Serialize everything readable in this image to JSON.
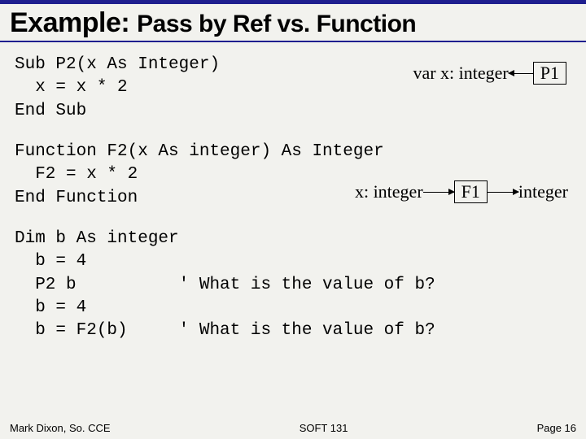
{
  "title_main": "Example: ",
  "title_sub": "Pass by Ref vs. Function",
  "code_block1": "Sub P2(x As Integer)\n  x = x * 2\nEnd Sub",
  "code_block2": "Function F2(x As integer) As Integer\n  F2 = x * 2\nEnd Function",
  "code_block3": "Dim b As integer\n  b = 4\n  P2 b          ' What is the value of b?\n  b = 4\n  b = F2(b)     ' What is the value of b?",
  "diag1": {
    "label": "var x: integer",
    "box": "P1"
  },
  "diag2": {
    "in": "x: integer",
    "box": "F1",
    "out": "integer"
  },
  "footer": {
    "left": "Mark Dixon, So. CCE",
    "center": "SOFT 131",
    "right": "Page 16"
  }
}
